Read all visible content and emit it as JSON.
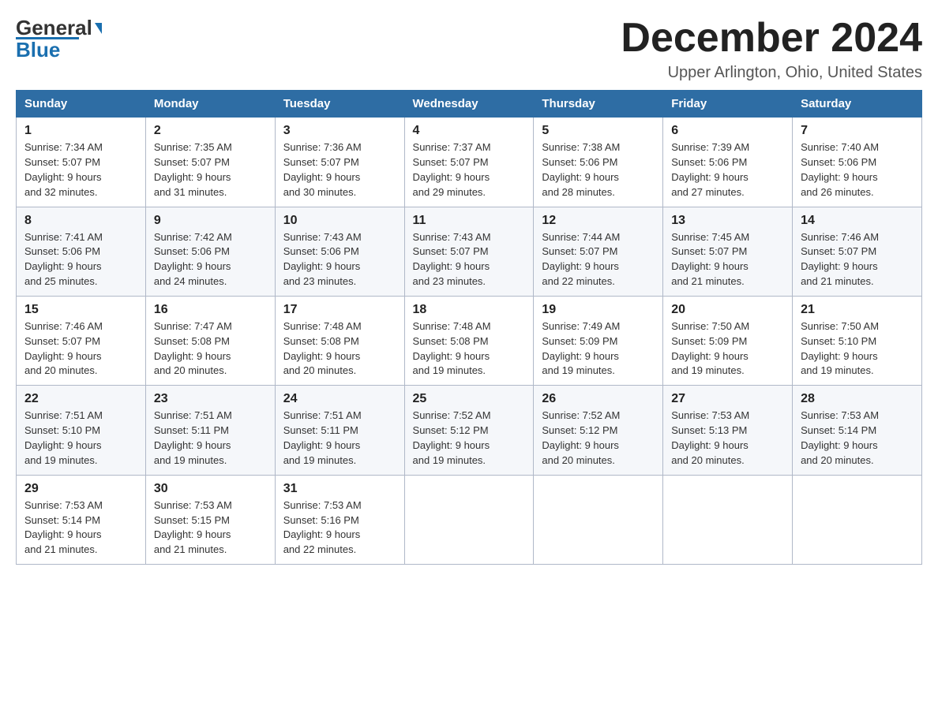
{
  "header": {
    "logo_general": "General",
    "logo_blue": "Blue",
    "month_year": "December 2024",
    "location": "Upper Arlington, Ohio, United States"
  },
  "days_of_week": [
    "Sunday",
    "Monday",
    "Tuesday",
    "Wednesday",
    "Thursday",
    "Friday",
    "Saturday"
  ],
  "weeks": [
    [
      {
        "num": "1",
        "sunrise": "7:34 AM",
        "sunset": "5:07 PM",
        "daylight": "9 hours and 32 minutes."
      },
      {
        "num": "2",
        "sunrise": "7:35 AM",
        "sunset": "5:07 PM",
        "daylight": "9 hours and 31 minutes."
      },
      {
        "num": "3",
        "sunrise": "7:36 AM",
        "sunset": "5:07 PM",
        "daylight": "9 hours and 30 minutes."
      },
      {
        "num": "4",
        "sunrise": "7:37 AM",
        "sunset": "5:07 PM",
        "daylight": "9 hours and 29 minutes."
      },
      {
        "num": "5",
        "sunrise": "7:38 AM",
        "sunset": "5:06 PM",
        "daylight": "9 hours and 28 minutes."
      },
      {
        "num": "6",
        "sunrise": "7:39 AM",
        "sunset": "5:06 PM",
        "daylight": "9 hours and 27 minutes."
      },
      {
        "num": "7",
        "sunrise": "7:40 AM",
        "sunset": "5:06 PM",
        "daylight": "9 hours and 26 minutes."
      }
    ],
    [
      {
        "num": "8",
        "sunrise": "7:41 AM",
        "sunset": "5:06 PM",
        "daylight": "9 hours and 25 minutes."
      },
      {
        "num": "9",
        "sunrise": "7:42 AM",
        "sunset": "5:06 PM",
        "daylight": "9 hours and 24 minutes."
      },
      {
        "num": "10",
        "sunrise": "7:43 AM",
        "sunset": "5:06 PM",
        "daylight": "9 hours and 23 minutes."
      },
      {
        "num": "11",
        "sunrise": "7:43 AM",
        "sunset": "5:07 PM",
        "daylight": "9 hours and 23 minutes."
      },
      {
        "num": "12",
        "sunrise": "7:44 AM",
        "sunset": "5:07 PM",
        "daylight": "9 hours and 22 minutes."
      },
      {
        "num": "13",
        "sunrise": "7:45 AM",
        "sunset": "5:07 PM",
        "daylight": "9 hours and 21 minutes."
      },
      {
        "num": "14",
        "sunrise": "7:46 AM",
        "sunset": "5:07 PM",
        "daylight": "9 hours and 21 minutes."
      }
    ],
    [
      {
        "num": "15",
        "sunrise": "7:46 AM",
        "sunset": "5:07 PM",
        "daylight": "9 hours and 20 minutes."
      },
      {
        "num": "16",
        "sunrise": "7:47 AM",
        "sunset": "5:08 PM",
        "daylight": "9 hours and 20 minutes."
      },
      {
        "num": "17",
        "sunrise": "7:48 AM",
        "sunset": "5:08 PM",
        "daylight": "9 hours and 20 minutes."
      },
      {
        "num": "18",
        "sunrise": "7:48 AM",
        "sunset": "5:08 PM",
        "daylight": "9 hours and 19 minutes."
      },
      {
        "num": "19",
        "sunrise": "7:49 AM",
        "sunset": "5:09 PM",
        "daylight": "9 hours and 19 minutes."
      },
      {
        "num": "20",
        "sunrise": "7:50 AM",
        "sunset": "5:09 PM",
        "daylight": "9 hours and 19 minutes."
      },
      {
        "num": "21",
        "sunrise": "7:50 AM",
        "sunset": "5:10 PM",
        "daylight": "9 hours and 19 minutes."
      }
    ],
    [
      {
        "num": "22",
        "sunrise": "7:51 AM",
        "sunset": "5:10 PM",
        "daylight": "9 hours and 19 minutes."
      },
      {
        "num": "23",
        "sunrise": "7:51 AM",
        "sunset": "5:11 PM",
        "daylight": "9 hours and 19 minutes."
      },
      {
        "num": "24",
        "sunrise": "7:51 AM",
        "sunset": "5:11 PM",
        "daylight": "9 hours and 19 minutes."
      },
      {
        "num": "25",
        "sunrise": "7:52 AM",
        "sunset": "5:12 PM",
        "daylight": "9 hours and 19 minutes."
      },
      {
        "num": "26",
        "sunrise": "7:52 AM",
        "sunset": "5:12 PM",
        "daylight": "9 hours and 20 minutes."
      },
      {
        "num": "27",
        "sunrise": "7:53 AM",
        "sunset": "5:13 PM",
        "daylight": "9 hours and 20 minutes."
      },
      {
        "num": "28",
        "sunrise": "7:53 AM",
        "sunset": "5:14 PM",
        "daylight": "9 hours and 20 minutes."
      }
    ],
    [
      {
        "num": "29",
        "sunrise": "7:53 AM",
        "sunset": "5:14 PM",
        "daylight": "9 hours and 21 minutes."
      },
      {
        "num": "30",
        "sunrise": "7:53 AM",
        "sunset": "5:15 PM",
        "daylight": "9 hours and 21 minutes."
      },
      {
        "num": "31",
        "sunrise": "7:53 AM",
        "sunset": "5:16 PM",
        "daylight": "9 hours and 22 minutes."
      },
      null,
      null,
      null,
      null
    ]
  ]
}
